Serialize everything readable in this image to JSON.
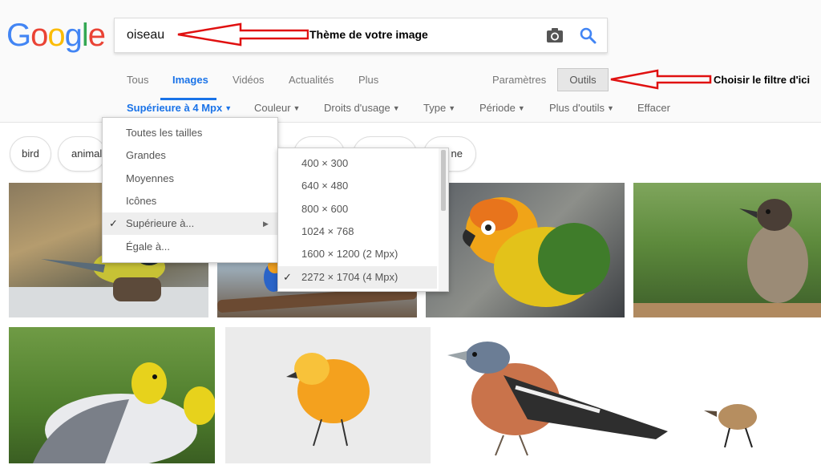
{
  "logo": {
    "letters": [
      "G",
      "o",
      "o",
      "g",
      "l",
      "e"
    ],
    "colors": [
      "#4285F4",
      "#EA4335",
      "#FBBC05",
      "#4285F4",
      "#34A853",
      "#EA4335"
    ]
  },
  "search": {
    "query": "oiseau",
    "camera_icon": "camera-icon",
    "search_icon": "search-icon"
  },
  "annotations": {
    "theme": "Thème de votre image",
    "filter": "Choisir le filtre d'ici"
  },
  "tabs": {
    "all": "Tous",
    "images": "Images",
    "videos": "Vidéos",
    "news": "Actualités",
    "more": "Plus",
    "settings": "Paramètres",
    "tools": "Outils"
  },
  "filters": {
    "size": "Supérieure à 4 Mpx",
    "color": "Couleur",
    "rights": "Droits d'usage",
    "type": "Type",
    "period": "Période",
    "more_tools": "Plus d'outils",
    "clear": "Effacer"
  },
  "chips": {
    "c1": "bird",
    "c2": "animal",
    "c6": "ne"
  },
  "size_menu": {
    "items": [
      "Toutes les tailles",
      "Grandes",
      "Moyennes",
      "Icônes",
      "Supérieure à...",
      "Égale à..."
    ],
    "selected": "Supérieure à..."
  },
  "submenu": {
    "items": [
      "400 × 300",
      "640 × 480",
      "800 × 600",
      "1024 × 768",
      "1600 × 1200 (2 Mpx)",
      "2272 × 1704 (4 Mpx)"
    ],
    "selected": "2272 × 1704 (4 Mpx)"
  },
  "colors": {
    "accent": "#1a73e8",
    "arrow": "#e01010"
  }
}
